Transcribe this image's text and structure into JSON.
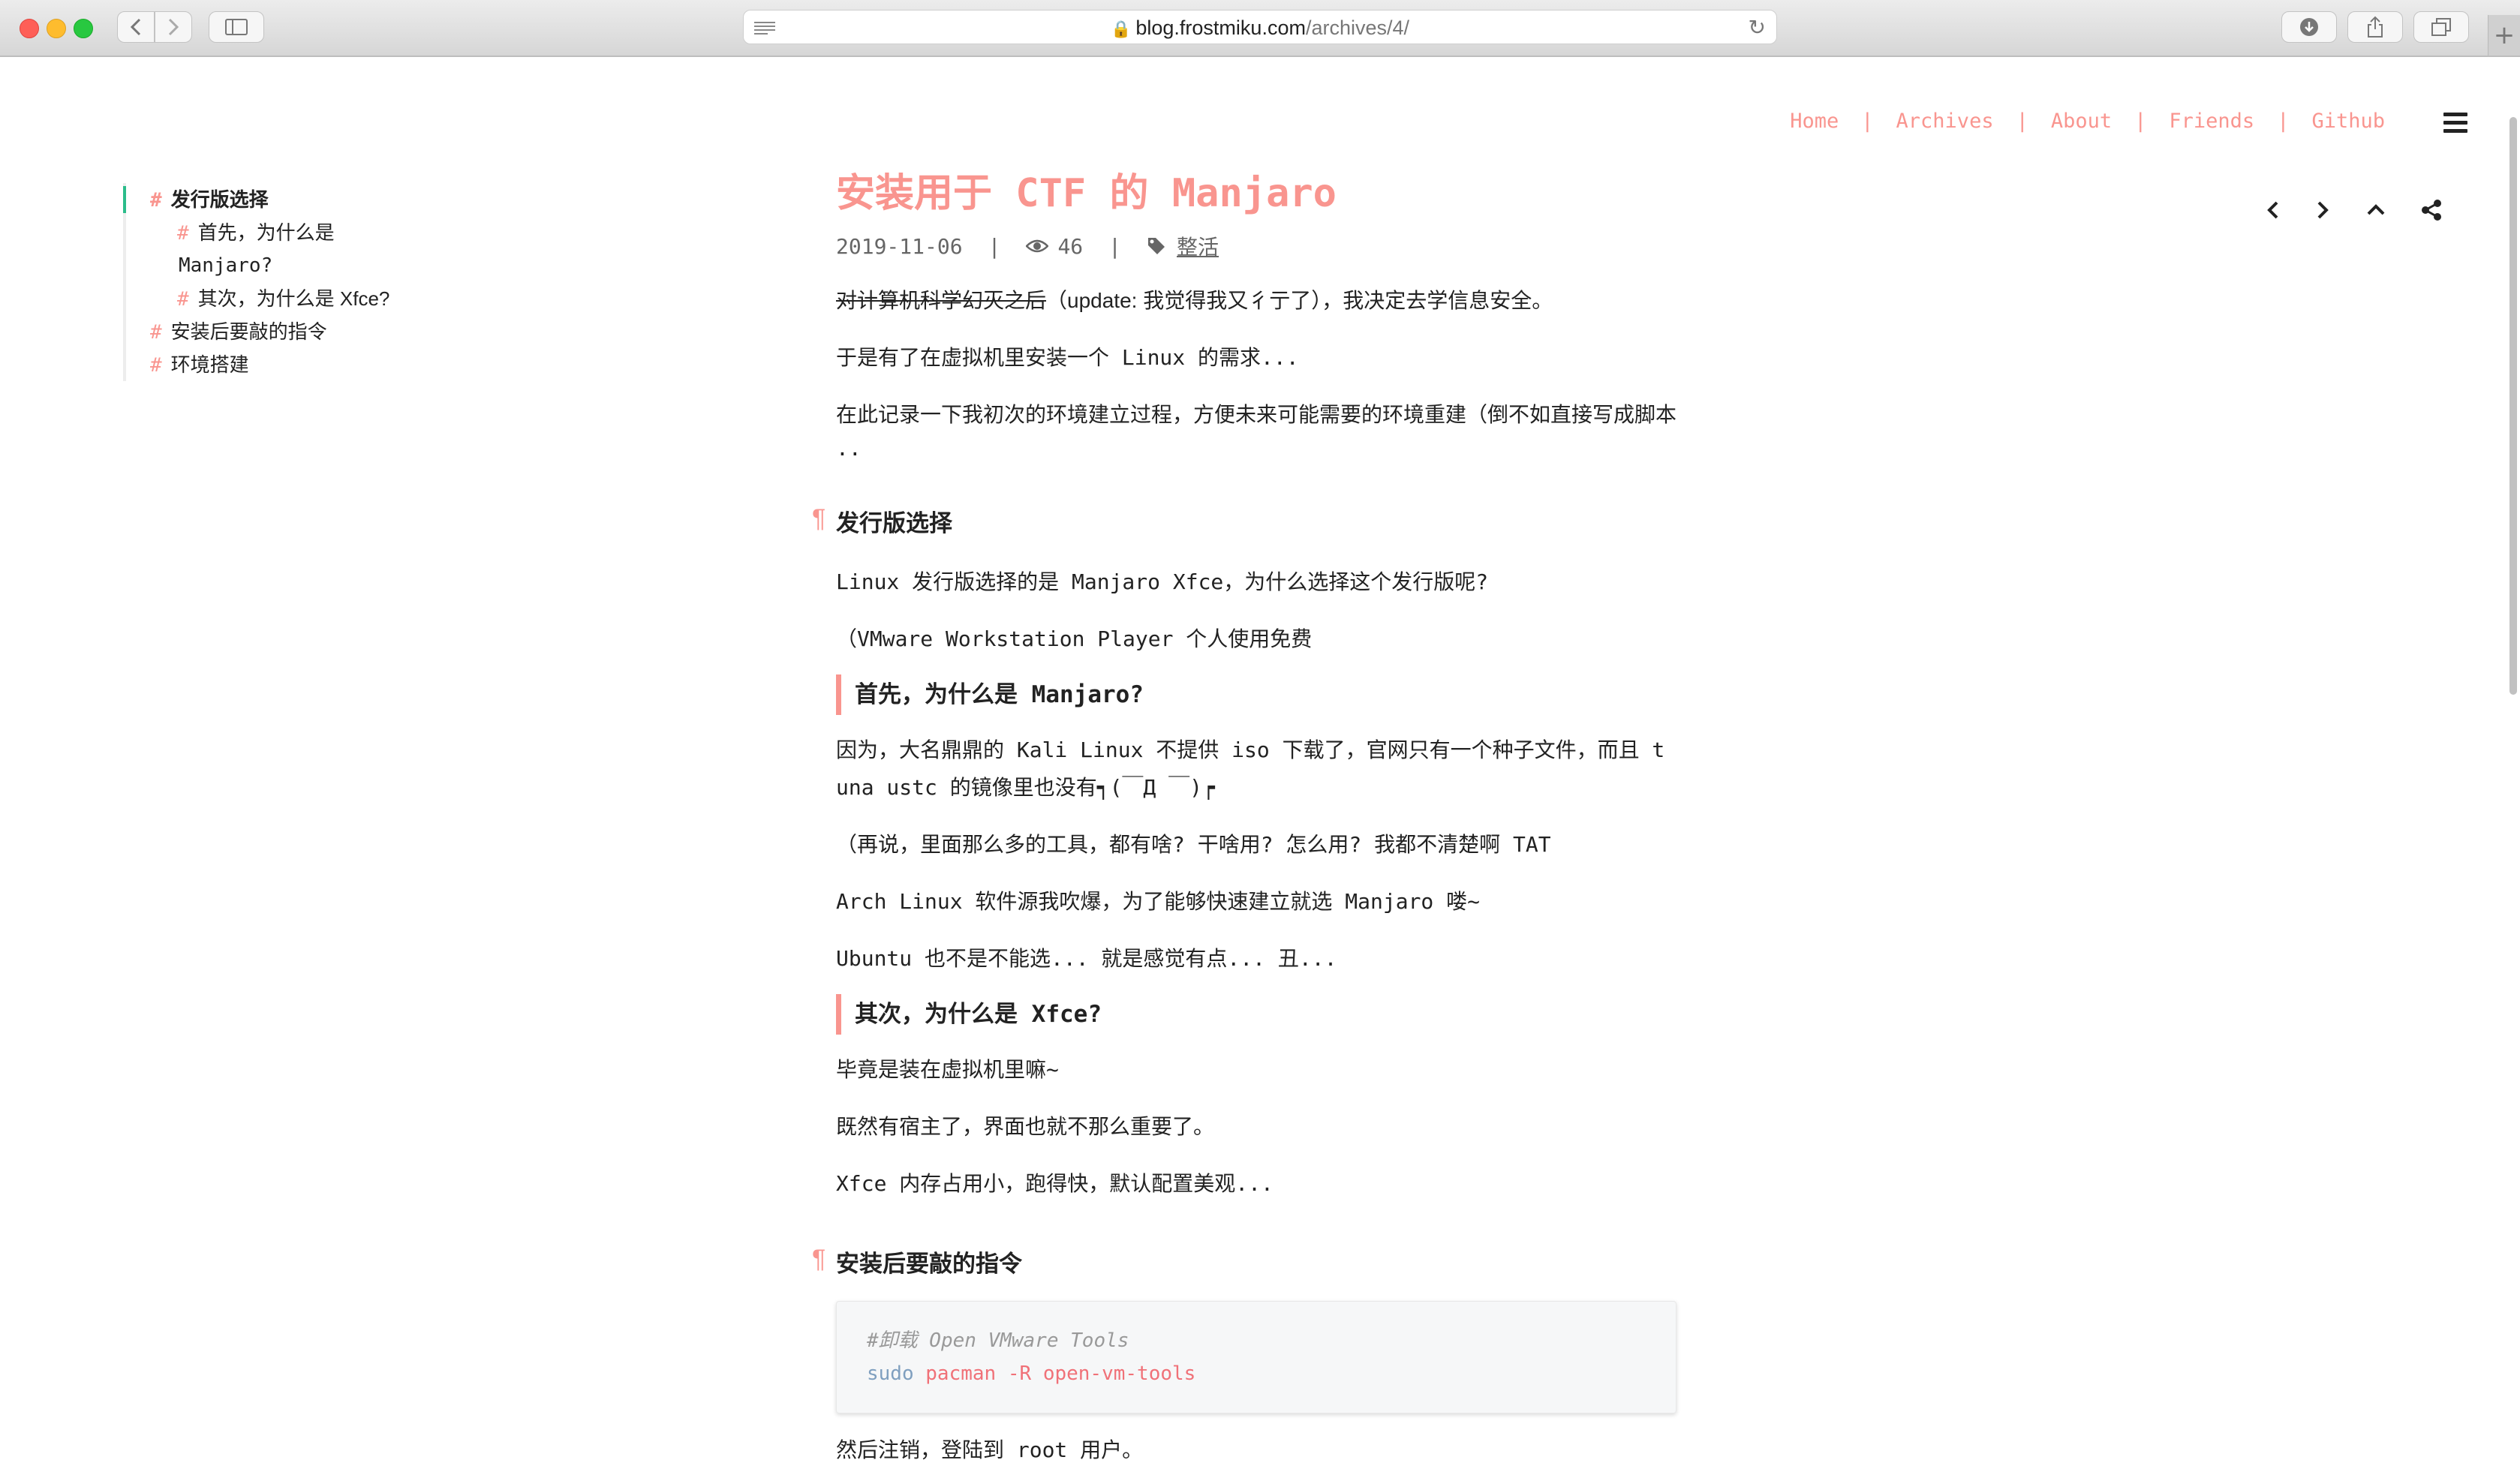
{
  "browser": {
    "url_host": "blog.frostmiku.com",
    "url_path": "/archives/4/"
  },
  "toc": {
    "items": [
      {
        "text": "发行版选择",
        "level": 1,
        "active": true
      },
      {
        "text": "首先，为什么是",
        "text2": "Manjaro?",
        "level": 2
      },
      {
        "text": "其次，为什么是 Xfce?",
        "level": 2
      },
      {
        "text": "安装后要敲的指令",
        "level": 1
      },
      {
        "text": "环境搭建",
        "level": 1
      }
    ],
    "hash": "#"
  },
  "nav": {
    "home": "Home",
    "archives": "Archives",
    "about": "About",
    "friends": "Friends",
    "github": "Github"
  },
  "post": {
    "title": "安装用于 CTF 的 Manjaro",
    "date": "2019-11-06",
    "views": "46",
    "tag": "整活",
    "intro_strike": "对计算机科学幻灭之后",
    "intro_rest": "（update: 我觉得我又彳亍了），我决定去学信息安全。",
    "p2": "于是有了在虚拟机里安装一个 Linux 的需求...",
    "p3_line1": "在此记录一下我初次的环境建立过程，方便未来可能需要的环境重建（倒不如直接写成脚本",
    "p3_line2": "..",
    "h2_distro": "发行版选择",
    "pilcrow": "¶",
    "distro_p1": "Linux 发行版选择的是 Manjaro Xfce，为什么选择这个发行版呢?",
    "distro_p2": "（VMware Workstation Player 个人使用免费",
    "h3_manjaro": "首先，为什么是 Manjaro?",
    "manjaro_p1_line1": "因为，大名鼎鼎的 Kali Linux 不提供 iso 下载了，官网只有一个种子文件，而且 t",
    "manjaro_p1_line2": "una ustc 的镜像里也没有┑(￣Д ￣)┍",
    "manjaro_p2": "（再说，里面那么多的工具，都有啥? 干啥用? 怎么用? 我都不清楚啊 TAT",
    "manjaro_p3": "Arch Linux 软件源我吹爆，为了能够快速建立就选 Manjaro 喽~",
    "manjaro_p4": "Ubuntu 也不是不能选... 就是感觉有点... 丑...",
    "h3_xfce": "其次，为什么是 Xfce?",
    "xfce_p1": "毕竟是装在虚拟机里嘛~",
    "xfce_p2": "既然有宿主了，界面也就不那么重要了。",
    "xfce_p3": "Xfce 内存占用小，跑得快，默认配置美观...",
    "h2_commands": "安装后要敲的指令",
    "code_comment": "#卸载 Open VMware Tools",
    "code_cmd": "sudo",
    "code_args": "pacman -R open-vm-tools",
    "after_code": "然后注销，登陆到 root 用户。"
  },
  "colors": {
    "accent": "#f9958f",
    "toc_active": "#2bbc8a"
  }
}
